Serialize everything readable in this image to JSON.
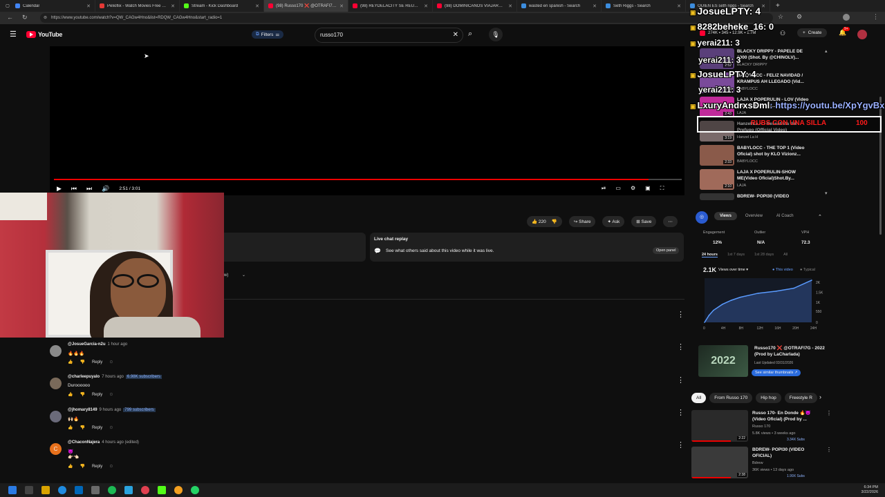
{
  "tabs": [
    {
      "label": "Calendar",
      "color": "#4285f4",
      "active": false
    },
    {
      "label": "Pelioflix - Watch Movies Free Onl",
      "color": "#e53935",
      "active": false
    },
    {
      "label": "Stream - Kick Dashboard",
      "color": "#53fc18",
      "active": false
    },
    {
      "label": "(98) Russo170 ❌ @OTRAFI7G - 2",
      "color": "#ff0033",
      "active": true
    },
    {
      "label": "(98) REYDELACITY SE REÚNE CON",
      "color": "#ff0033",
      "active": false
    },
    {
      "label": "(98) DOMINICANOS VIAJARON A",
      "color": "#ff0033",
      "active": false
    },
    {
      "label": "wasted en spanish - Search",
      "color": "#3c8dde",
      "active": false
    },
    {
      "label": "Seth Riggs - Search",
      "color": "#3c8dde",
      "active": false
    },
    {
      "label": "QUIEN ES seth riggs - Search",
      "color": "#3c8dde",
      "active": false
    }
  ],
  "address": "https://www.youtube.com/watch?v=QW_CAGw4Hno&list=RDQW_CAGw4Hno&start_radio=1",
  "header": {
    "logo": "YouTube",
    "filters": "Filters",
    "search_value": "russo170",
    "create": "Create",
    "notif_count": "9+",
    "stats": "274K ▪ 345 ▪ 12.9K ▪ 1.7M"
  },
  "player": {
    "time": "2:51 / 3:01",
    "progress": 0.947
  },
  "actions": {
    "likes": "220",
    "share": "Share",
    "ask": "Ask",
    "save": "Save"
  },
  "live_chat": {
    "title": "Live chat replay",
    "desc": "See what others said about this video while it was live.",
    "open": "Open panel"
  },
  "comments": [
    {
      "user": "@JosueGarcia-n2u",
      "time": "1 hour ago",
      "subs": "",
      "text": "🔥🔥🔥",
      "avatar": "#8a8a8a"
    },
    {
      "user": "@charleepuyalo",
      "time": "7 hours ago",
      "subs": "6.98K subscribers",
      "text": "Duroooooo",
      "avatar": "#7a6a5a"
    },
    {
      "user": "@jhomary8149",
      "time": "9 hours ago",
      "subs": "799 subscribers",
      "text": "🙌🏻🔥",
      "avatar": "#6a6a7a"
    },
    {
      "user": "@ChaconNajera",
      "time": "4 hours ago (edited)",
      "subs": "",
      "text": "😈\n👉🏻👈🏻",
      "avatar": "#e8711c",
      "initial": "C"
    }
  ],
  "reply_label": "Reply",
  "playlist": [
    {
      "title": "BLACKY DRIPPY - PAPELE DE 1000 (Shot. By @CHINOLV)...",
      "channel": "BLACKY DRIPPY",
      "dur": "2:52",
      "color": "#5a3f7a"
    },
    {
      "title": "BABYLOCC - FELIZ NAVIDAD / KRAMPUS AH LLEGADO (Vid...",
      "channel": "BABYLOCC",
      "dur": "3:44",
      "color": "#7a4a9a"
    },
    {
      "title": "LAJA X POPERULIN - LOV (Video Oficial) (Prod By...",
      "channel": "LAJA",
      "dur": "2:43",
      "color": "#c02a9a"
    },
    {
      "title": "Hanzel La H - Rescatista del Prefugo (Official Video)",
      "channel": "Hanzel La H",
      "dur": "3:19",
      "color": "#7a6a6a"
    },
    {
      "title": "BABYLOCC - THE TOP 1 (Video Oficial) shot by KLO Vizionz...",
      "channel": "BABYLOCC",
      "dur": "2:33",
      "color": "#8a5a4a"
    },
    {
      "title": "LAJA X POPERULIN-SHOW ME(Video Oficial)Shot.By...",
      "channel": "LAJA",
      "dur": "2:10",
      "color": "#a06a5a"
    },
    {
      "title": "BDREW- POPI30 (VIDEO",
      "channel": "",
      "dur": "",
      "color": "#333"
    }
  ],
  "analytics": {
    "tabs": [
      "Views",
      "Overview",
      "AI Coach"
    ],
    "engagement_label": "Engagement",
    "engagement": "12%",
    "outlier_label": "Outlier",
    "outlier": "N/A",
    "vph_label": "VPH",
    "vph": "72.3",
    "ranges": [
      "24 hours",
      "1st 7 days",
      "1st 28 days",
      "All"
    ],
    "views": "2.1K",
    "views_label": "Views over time ▾",
    "legend_this": "This video",
    "legend_typical": "Typical",
    "y_ticks": [
      "2K",
      "1.5K",
      "1K",
      "550",
      "0"
    ],
    "x_ticks": [
      "0",
      "4H",
      "8H",
      "12H",
      "16H",
      "20H",
      "24H"
    ],
    "video_title": "Russo170 ❌ @OTRAFI7G - 2022 (Prod by LaCharlada)",
    "last_updated": "Last Updated 03/31/2026",
    "similar": "See similar thumbnails ↗"
  },
  "chart_data": {
    "type": "line",
    "title": "",
    "xlabel": "",
    "ylabel": "",
    "x_ticks": [
      "0",
      "4H",
      "8H",
      "12H",
      "16H",
      "20H",
      "24H"
    ],
    "ylim": [
      0,
      2200
    ],
    "series": [
      {
        "name": "This video",
        "x": [
          0,
          1,
          2,
          4,
          6,
          8,
          12,
          16,
          20,
          24
        ],
        "y": [
          0,
          350,
          600,
          900,
          1100,
          1250,
          1450,
          1550,
          1700,
          2100
        ]
      }
    ]
  },
  "chips": [
    "All",
    "From Russo 170",
    "Hip hop",
    "Freestyle R"
  ],
  "recs": [
    {
      "title": "Russo 170- En Donde 🔥😈 (Video Oficial) (Prod by ...",
      "channel": "Russo 170",
      "meta": "5.8K views • 3 weeks ago",
      "badge": "3.34X Subs",
      "dur": "2:22",
      "color": "#2a2a2a"
    },
    {
      "title": "BDREW- POPI30 (VIDEO OFICIAL)",
      "channel": "Bdrew",
      "meta": "36K views • 13 days ago",
      "badge": "1.99X Subs",
      "dur": "2:38",
      "color": "#3a3a3a"
    }
  ],
  "chat_overlay": [
    {
      "user": "JosueLPTY",
      "msg": ": 4"
    },
    {
      "user": "8282beheke_16",
      "msg": ": 0"
    },
    {
      "user": "yerai211",
      "msg": ": 3"
    },
    {
      "user": "yerai211",
      "msg": ": 3"
    },
    {
      "user": "JosueLPTY",
      "msg": ": 4"
    },
    {
      "user": "yerai211",
      "msg": ": 3"
    },
    {
      "user": "LxuryAndrxsDml",
      "msg": ": https://youtu.be/XpYgvBx"
    }
  ],
  "highlight": {
    "text": "RUBS CON UNA SILLA",
    "amount": "100"
  },
  "clock": {
    "time": "6:34 PM",
    "date": "3/22/2026"
  }
}
